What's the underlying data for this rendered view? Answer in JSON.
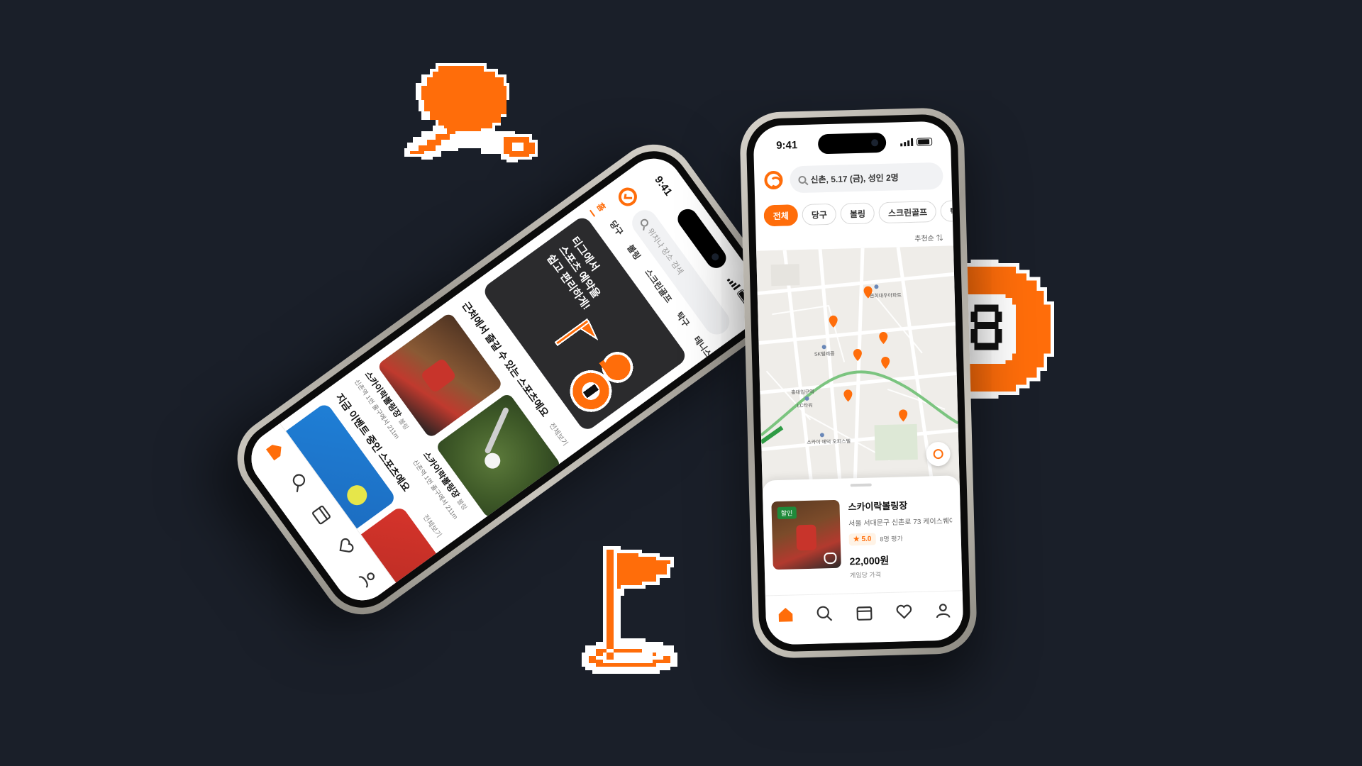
{
  "colors": {
    "background": "#1a1f29",
    "accent": "#ff6d0a",
    "banner": "#2b2b2d"
  },
  "stickers": {
    "ping_pong": "ping-pong-paddle-icon",
    "billiard_ball": "eight-ball-icon",
    "golf_flag": "golf-flag-icon"
  },
  "map_phone": {
    "status_time": "9:41",
    "search_text": "신촌, 5.17 (금), 성인 2명",
    "chips": [
      "전체",
      "당구",
      "볼링",
      "스크린골프",
      "탁구"
    ],
    "sort_label": "추천순 ⇅",
    "map_labels": [
      "연희대우아파트",
      "SK텔레콤",
      "홍대입구역",
      "LC타워",
      "스카이 에덕 오피스텔"
    ],
    "venue": {
      "badge": "할인",
      "name": "스카이락볼링장",
      "address": "서울 서대문구 신촌로 73 케이스퀘어...",
      "rating": "★ 5.0",
      "rating_count": "8명 평가",
      "price": "22,000원",
      "price_unit": "게임당 가격"
    },
    "tabs": [
      "home-icon",
      "search-icon",
      "calendar-icon",
      "heart-icon",
      "profile-icon"
    ]
  },
  "home_phone": {
    "status_time": "9:41",
    "search_placeholder": "위치나 장소 검색",
    "tabs": [
      "홈",
      "당구",
      "볼링",
      "스크린골프",
      "탁구",
      "테니스"
    ],
    "banner_lines": [
      "티그에서",
      "스포츠 예약을",
      "쉽고 편리하게!"
    ],
    "nearby_title": "근처에서 즐길 수 있는 스포츠예요",
    "see_all": "전체보기",
    "cards": [
      {
        "name": "스카이락볼링장",
        "tag": "볼링",
        "sub": "신촌역 1번 출구에서 211m"
      },
      {
        "name": "스카이락볼링장",
        "tag": "볼링",
        "sub": "신촌역 1번 출구에서 211m"
      }
    ],
    "events_title": "지금 이벤트 중인 스포츠예요",
    "events_see_all": "전체보기"
  }
}
